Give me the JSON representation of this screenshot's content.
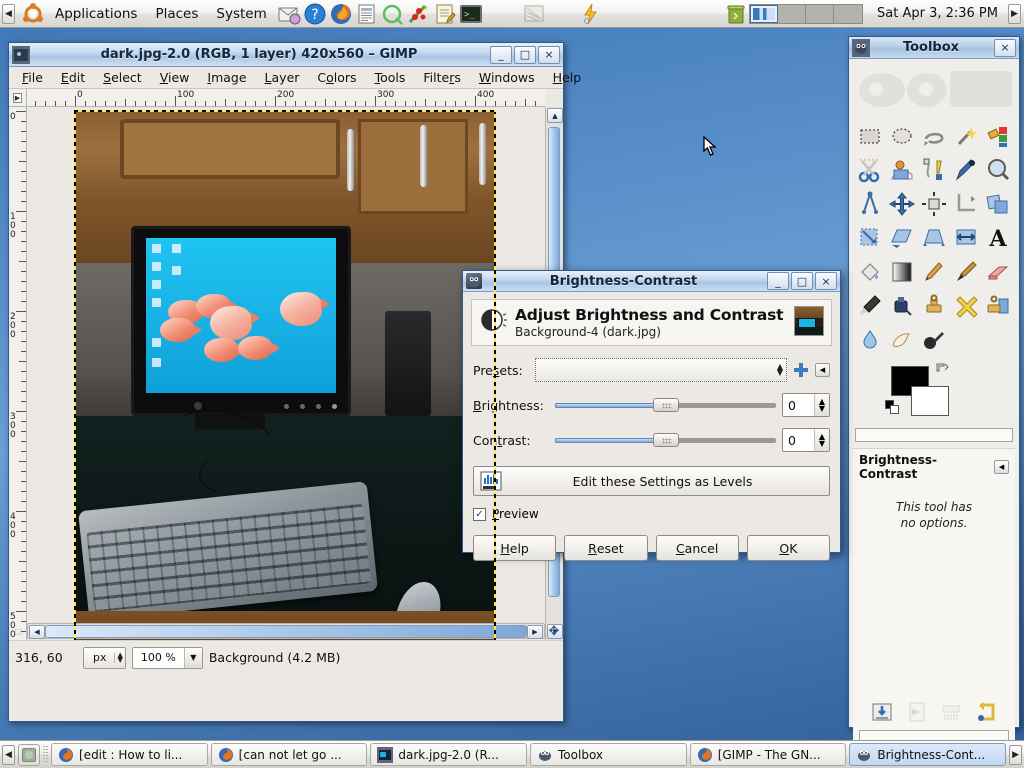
{
  "top_panel": {
    "collapse_arrow": "◀",
    "menus": [
      "Applications",
      "Places",
      "System"
    ],
    "launchers": [
      {
        "name": "evolution-mail-icon",
        "title": "Evolution Mail"
      },
      {
        "name": "help-icon",
        "title": "Help"
      },
      {
        "name": "firefox-icon",
        "title": "Firefox Web Browser"
      },
      {
        "name": "text-document-icon",
        "title": "Document Viewer"
      },
      {
        "name": "quod-libet-icon",
        "title": "Q"
      },
      {
        "name": "xchat-icon",
        "title": "XChat IRC"
      },
      {
        "name": "text-editor-icon",
        "title": "Text Editor"
      },
      {
        "name": "terminal-icon",
        "title": "Terminal"
      },
      {
        "name": "window-tool-icon",
        "title": "Window Tool"
      }
    ],
    "tray": [
      {
        "name": "update-notifier-icon",
        "title": "Update Notifier"
      },
      {
        "name": "trash-icon",
        "title": "Trash"
      }
    ],
    "workspaces": 4,
    "active_workspace": 1,
    "clock": "Sat Apr  3,  2:36 PM",
    "expand_arrow": "▶"
  },
  "gimp_window": {
    "title": "dark.jpg-2.0 (RGB, 1 layer) 420x560 – GIMP",
    "window_buttons": {
      "minimize": "_",
      "maximize": "□",
      "close": "×"
    },
    "menubar": [
      "File",
      "Edit",
      "Select",
      "View",
      "Image",
      "Layer",
      "Colors",
      "Tools",
      "Filters",
      "Windows",
      "Help"
    ],
    "hruler_labels": [
      "0",
      "100",
      "200",
      "300",
      "400"
    ],
    "vruler_labels": [
      "0",
      "100",
      "200",
      "300",
      "400",
      "500"
    ],
    "statusbar": {
      "position": "316, 60",
      "unit": "px",
      "zoom": "100 %",
      "layer_info": "Background (4.2 MB)"
    }
  },
  "toolbox": {
    "title": "Toolbox",
    "close_label": "×",
    "tools": [
      {
        "name": "rect-select-tool",
        "label": "Rectangle Select"
      },
      {
        "name": "ellipse-select-tool",
        "label": "Ellipse Select"
      },
      {
        "name": "free-select-tool",
        "label": "Free Select (Lasso)"
      },
      {
        "name": "fuzzy-select-tool",
        "label": "Fuzzy Select (Magic Wand)"
      },
      {
        "name": "select-by-color-tool",
        "label": "Select by Color"
      },
      {
        "name": "scissors-select-tool",
        "label": "Intelligent Scissors"
      },
      {
        "name": "foreground-select-tool",
        "label": "Foreground Select"
      },
      {
        "name": "paths-tool",
        "label": "Paths"
      },
      {
        "name": "color-picker-tool",
        "label": "Color Picker"
      },
      {
        "name": "zoom-tool",
        "label": "Zoom"
      },
      {
        "name": "measure-tool",
        "label": "Measure"
      },
      {
        "name": "move-tool",
        "label": "Move"
      },
      {
        "name": "alignment-tool",
        "label": "Alignment"
      },
      {
        "name": "crop-tool",
        "label": "Crop"
      },
      {
        "name": "rotate-tool",
        "label": "Rotate"
      },
      {
        "name": "scale-tool",
        "label": "Scale"
      },
      {
        "name": "shear-tool",
        "label": "Shear"
      },
      {
        "name": "perspective-tool",
        "label": "Perspective"
      },
      {
        "name": "flip-tool",
        "label": "Flip"
      },
      {
        "name": "text-tool",
        "label": "Text"
      },
      {
        "name": "bucket-fill-tool",
        "label": "Bucket Fill"
      },
      {
        "name": "gradient-tool",
        "label": "Blend / Gradient"
      },
      {
        "name": "pencil-tool",
        "label": "Pencil"
      },
      {
        "name": "paintbrush-tool",
        "label": "Paintbrush"
      },
      {
        "name": "eraser-tool",
        "label": "Eraser"
      },
      {
        "name": "airbrush-tool",
        "label": "Airbrush"
      },
      {
        "name": "ink-tool",
        "label": "Ink"
      },
      {
        "name": "clone-tool",
        "label": "Clone"
      },
      {
        "name": "heal-tool",
        "label": "Heal"
      },
      {
        "name": "perspective-clone-tool",
        "label": "Perspective Clone"
      },
      {
        "name": "blur-sharpen-tool",
        "label": "Blur / Sharpen"
      },
      {
        "name": "smudge-tool",
        "label": "Smudge"
      },
      {
        "name": "dodge-burn-tool",
        "label": "Dodge / Burn"
      }
    ],
    "colors": {
      "foreground": "#000000",
      "background": "#ffffff"
    },
    "tool_options": {
      "title": "Brightness-Contrast",
      "message_line1": "This tool has",
      "message_line2": "no options.",
      "menu_arrow": "◀",
      "buttons": [
        {
          "name": "save-options-button",
          "label": "Save tool options"
        },
        {
          "name": "restore-options-button",
          "label": "Restore tool options"
        },
        {
          "name": "delete-options-button",
          "label": "Delete tool options"
        },
        {
          "name": "reset-options-button",
          "label": "Reset tool options"
        }
      ]
    }
  },
  "brightness_contrast_dialog": {
    "window_title": "Brightness-Contrast",
    "window_buttons": {
      "minimize": "_",
      "maximize": "□",
      "close": "×"
    },
    "heading": "Adjust Brightness and Contrast",
    "subheading": "Background-4 (dark.jpg)",
    "presets_label": "Presets:",
    "presets_value": "",
    "add_preset_label": "+",
    "preset_menu_arrow": "◀",
    "brightness": {
      "label": "Brightness:",
      "value": "0",
      "min": -127,
      "max": 127,
      "slider_pct": 50
    },
    "contrast": {
      "label": "Contrast:",
      "value": "0",
      "min": -127,
      "max": 127,
      "slider_pct": 50
    },
    "levels_button_label": "Edit these Settings as Levels",
    "preview_label": "Preview",
    "preview_checked": "✓",
    "buttons": [
      {
        "name": "help-button",
        "label": "Help"
      },
      {
        "name": "reset-button",
        "label": "Reset"
      },
      {
        "name": "cancel-button",
        "label": "Cancel"
      },
      {
        "name": "ok-button",
        "label": "OK"
      }
    ]
  },
  "taskbar": {
    "left_arrow": "◀",
    "right_arrow": "▶",
    "items": [
      {
        "name": "task-firefox-edit",
        "label": "[edit : How to li...",
        "icon": "firefox-icon",
        "active": false
      },
      {
        "name": "task-firefox-cannot",
        "label": "[can not let go ...",
        "icon": "firefox-icon",
        "active": false
      },
      {
        "name": "task-gimp-image",
        "label": "dark.jpg-2.0 (R...",
        "icon": "image-icon",
        "active": false
      },
      {
        "name": "task-gimp-toolbox",
        "label": "Toolbox",
        "icon": "gimp-icon",
        "active": false
      },
      {
        "name": "task-firefox-gimp",
        "label": "[GIMP - The GN...",
        "icon": "firefox-icon",
        "active": false
      },
      {
        "name": "task-brightness-contrast",
        "label": "Brightness-Cont...",
        "icon": "gimp-icon",
        "active": true
      }
    ]
  },
  "colors": {
    "desktop_blue": "#4d85c3",
    "title_active": "#a9c6e4",
    "accent": "#3d7ac2"
  }
}
